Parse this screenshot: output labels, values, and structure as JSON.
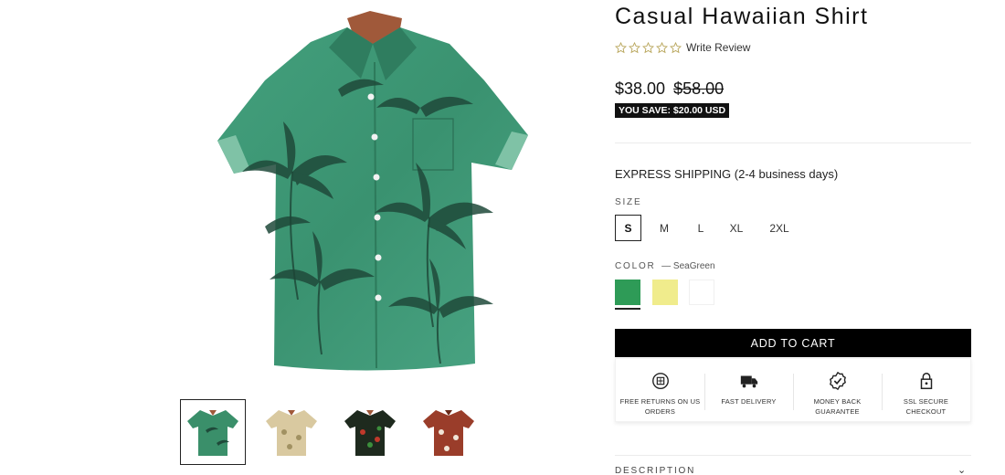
{
  "product": {
    "title": "Casual Hawaiian Shirt",
    "review_label": "Write Review",
    "rating_stars": 5,
    "rating_value": 0,
    "price": "$38.00",
    "compare_price": "$58.00",
    "savings": "YOU SAVE: $20.00 USD"
  },
  "shipping": "EXPRESS SHIPPING (2-4 business days)",
  "size": {
    "label": "SIZE",
    "options": [
      "S",
      "M",
      "L",
      "XL",
      "2XL"
    ],
    "selected": "S"
  },
  "color": {
    "label": "COLOR",
    "selected_label": "— SeaGreen",
    "swatches": [
      {
        "name": "SeaGreen",
        "hex": "#2e9b57"
      },
      {
        "name": "Yellow",
        "hex": "#f0ec8c"
      },
      {
        "name": "White",
        "hex": "#ffffff"
      }
    ]
  },
  "add_to_cart": "ADD TO CART",
  "trust_badges": [
    {
      "icon": "returns-icon",
      "label": "FREE RETURNS ON US ORDERS"
    },
    {
      "icon": "truck-icon",
      "label": "FAST DELIVERY"
    },
    {
      "icon": "guarantee-check-icon",
      "label": "MONEY BACK GUARANTEE"
    },
    {
      "icon": "lock-icon",
      "label": "SSL SECURE CHECKOUT"
    }
  ],
  "description_label": "DESCRIPTION",
  "gallery": {
    "thumbnails": [
      {
        "name": "green-palm-shirt",
        "color": "#3a8f6a"
      },
      {
        "name": "beige-leaf-shirt",
        "color": "#d9c9a0"
      },
      {
        "name": "black-tropical-shirt",
        "color": "#1e2a1e"
      },
      {
        "name": "red-floral-shirt",
        "color": "#9a3d2a"
      }
    ],
    "active_index": 0
  },
  "colors": {
    "shirt_green": "#3f9b79",
    "palm_dark": "#1f4a3a",
    "accent_black": "#000000",
    "star_outline": "#b8a55a"
  }
}
